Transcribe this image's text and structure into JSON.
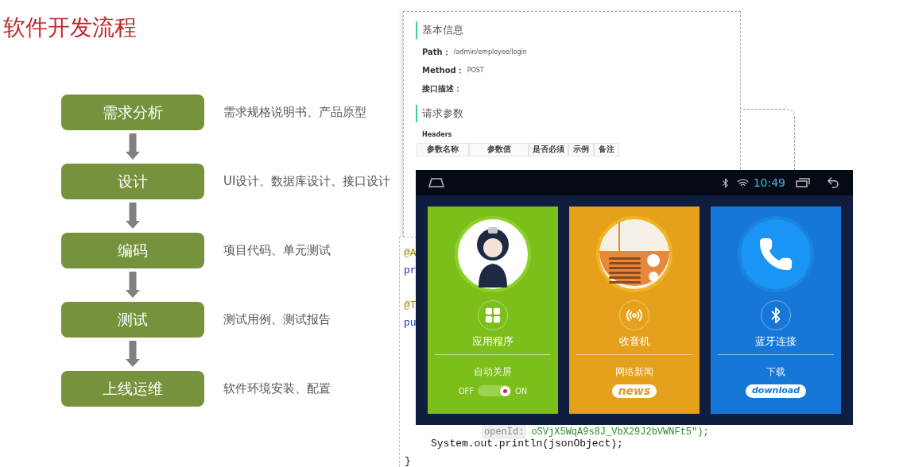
{
  "title": "软件开发流程",
  "steps": [
    {
      "name": "需求分析",
      "description": "需求规格说明书、产品原型"
    },
    {
      "name": "设计",
      "description": "UI设计、数据库设计、接口设计"
    },
    {
      "name": "编码",
      "description": "项目代码、单元测试"
    },
    {
      "name": "测试",
      "description": "测试用例、测试报告"
    },
    {
      "name": "上线运维",
      "description": "软件环境安装、配置"
    }
  ],
  "api_doc": {
    "basic_heading": "基本信息",
    "fields": [
      {
        "label": "Path：",
        "value": "/admin/employee/login"
      },
      {
        "label": "Method：",
        "value": "POST"
      },
      {
        "label": "接口描述："
      }
    ],
    "params_heading": "请求参数",
    "headers_label": "Headers",
    "table_columns": [
      "参数名称",
      "参数值",
      "是否必须",
      "示例",
      "备注"
    ]
  },
  "code": {
    "fragments": [
      {
        "kind": "annotation",
        "text": "@A"
      },
      {
        "kind": "keyword",
        "text": "pr"
      },
      {
        "kind": "annotation",
        "text": "@T"
      },
      {
        "kind": "keyword",
        "text": "pu"
      }
    ],
    "openid_label": "openId:",
    "openid_value": "oSVjX5WqA9s8J_VbX29J2bVWNFt5\");",
    "statement": "System.out.println(jsonObject);",
    "closing": "}"
  },
  "android": {
    "time": "10:49",
    "cards": [
      {
        "kind": "apps",
        "color": "#7cbf1a",
        "label": "应用程序",
        "sub_label": "自动关屏",
        "toggle": {
          "off_label": "OFF",
          "on_label": "ON",
          "on": true
        }
      },
      {
        "kind": "radio",
        "color": "#e6a11c",
        "label": "收音机",
        "sub_label": "网络新闻",
        "badge": "news"
      },
      {
        "kind": "phone",
        "color": "#1677d8",
        "label": "蓝牙连接",
        "sub_label": "下载",
        "badge": "download"
      }
    ]
  }
}
